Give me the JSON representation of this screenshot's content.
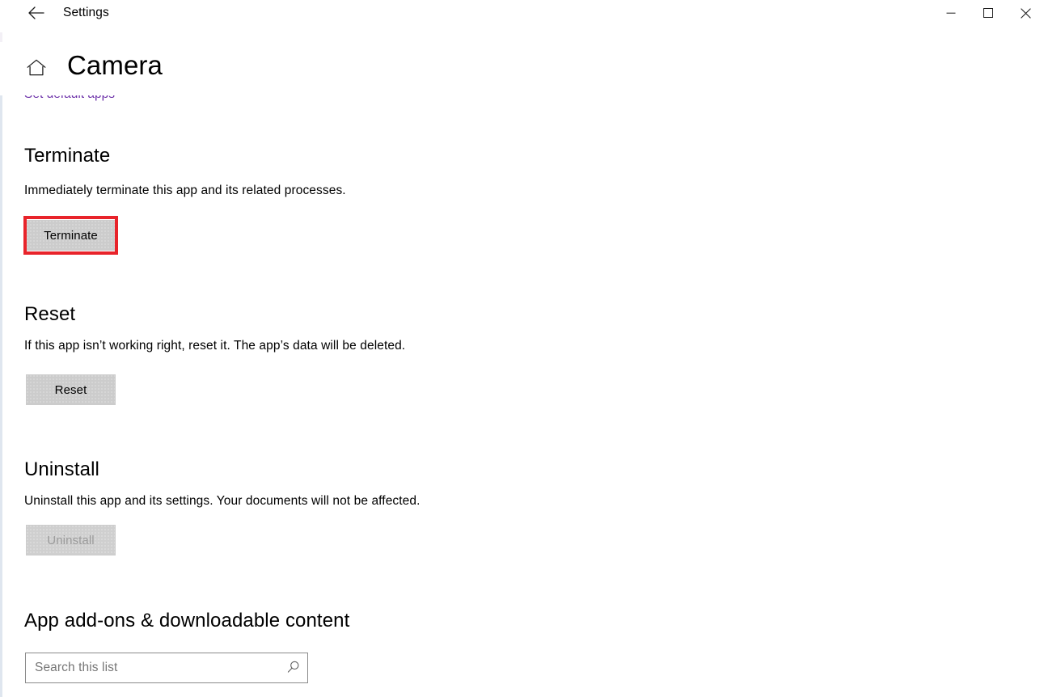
{
  "window": {
    "app_title": "Settings",
    "back_icon": "back-arrow-icon",
    "minimize_icon": "minimize-icon",
    "maximize_icon": "maximize-icon",
    "close_icon": "close-icon"
  },
  "header": {
    "home_icon": "home-icon",
    "page_title": "Camera"
  },
  "clipped_link": {
    "label": "Set default apps",
    "color": "#6b2fa8"
  },
  "sections": [
    {
      "id": "terminate",
      "heading": "Terminate",
      "description": "Immediately terminate this app and its related processes.",
      "button_label": "Terminate",
      "disabled": false,
      "highlighted": true
    },
    {
      "id": "reset",
      "heading": "Reset",
      "description": "If this app isn’t working right, reset it. The app’s data will be deleted.",
      "button_label": "Reset",
      "disabled": false,
      "highlighted": false
    },
    {
      "id": "uninstall",
      "heading": "Uninstall",
      "description": "Uninstall this app and its settings. Your documents will not be affected.",
      "button_label": "Uninstall",
      "disabled": true,
      "highlighted": false
    }
  ],
  "addons": {
    "heading": "App add-ons & downloadable content",
    "search_placeholder": "Search this list",
    "search_value": "",
    "search_icon": "search-icon"
  },
  "colors": {
    "highlight": "#e8232a",
    "link": "#6b2fa8",
    "button_face": "#cccccc",
    "disabled_text": "#9a9a9a"
  }
}
